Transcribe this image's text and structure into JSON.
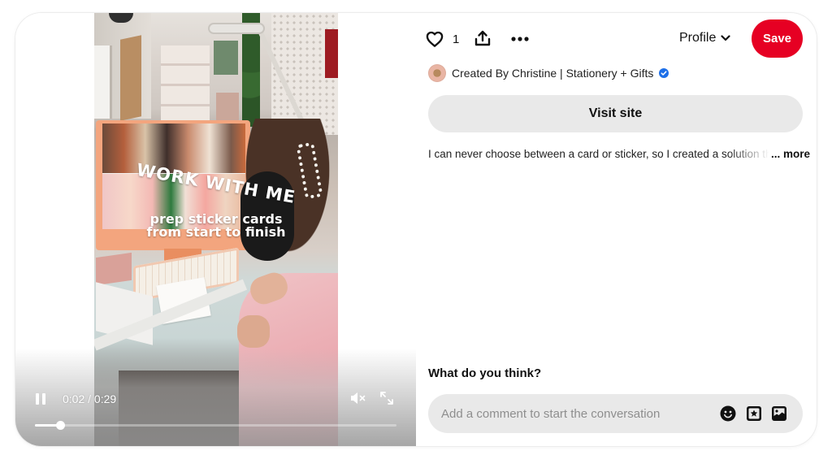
{
  "video": {
    "overlay_headline": "WORK WITH ME",
    "overlay_line1": "prep sticker cards",
    "overlay_line2": "from start to finish",
    "current_time": "0:02",
    "time_separator": " / ",
    "duration": "0:29",
    "progress": 0.069,
    "playing": true,
    "muted": true,
    "icons": {
      "pause": "pause-icon",
      "mute": "volume-muted-icon",
      "fullscreen": "expand-icon"
    }
  },
  "actions": {
    "like_icon": "heart-icon",
    "like_count": "1",
    "share_icon": "share-upload-icon",
    "more_icon": "ellipsis-icon",
    "profile_label": "Profile",
    "save_label": "Save"
  },
  "creator": {
    "name": "Created By Christine | Stationery + Gifts",
    "verified": true
  },
  "visit_site_label": "Visit site",
  "description": {
    "text": "I can never choose between a card or sticker, so I created a solution that",
    "more_label": "... more"
  },
  "comments": {
    "heading": "What do you think?",
    "placeholder": "Add a comment to start the conversation",
    "icons": [
      "emoji-icon",
      "sticker-icon",
      "image-icon"
    ]
  },
  "colors": {
    "save_red": "#e60023",
    "verified_blue": "#1d6fe8",
    "button_gray": "#e9e9e9"
  }
}
